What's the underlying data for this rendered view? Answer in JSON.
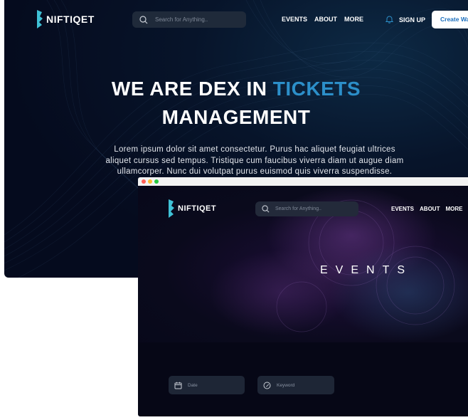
{
  "brand": {
    "name": "NIFTIQET"
  },
  "hero": {
    "search_placeholder": "Search for Anything..",
    "nav": [
      "EVENTS",
      "ABOUT",
      "MORE"
    ],
    "sign_up": "SIGN UP",
    "create_wallet": "Create Wallet",
    "headline_part1": "WE ARE DEX IN ",
    "headline_accent": "TICKETS",
    "headline_line2": "MANAGEMENT",
    "lead_line1": "Lorem ipsum dolor sit amet consectetur. Purus hac aliquet feugiat ultrices",
    "lead_line2": "aliquet cursus sed tempus. Tristique cum faucibus viverra diam ut augue diam",
    "lead_line3": "ullamcorper. Nunc dui volutpat purus euismod quis viverra suspendisse."
  },
  "events_page": {
    "search_placeholder": "Search for Anything..",
    "nav": [
      "EVENTS",
      "ABOUT",
      "MORE"
    ],
    "title": "EVENTS",
    "filters": {
      "date_placeholder": "Date",
      "keyword_placeholder": "Keyword"
    }
  },
  "colors": {
    "accent": "#2c8fc9",
    "wallet_text": "#1b6fbe",
    "dark_bg": "#060716"
  },
  "icons": [
    "logo-mark-icon",
    "search-icon",
    "bell-icon",
    "calendar-icon",
    "keyword-icon"
  ]
}
